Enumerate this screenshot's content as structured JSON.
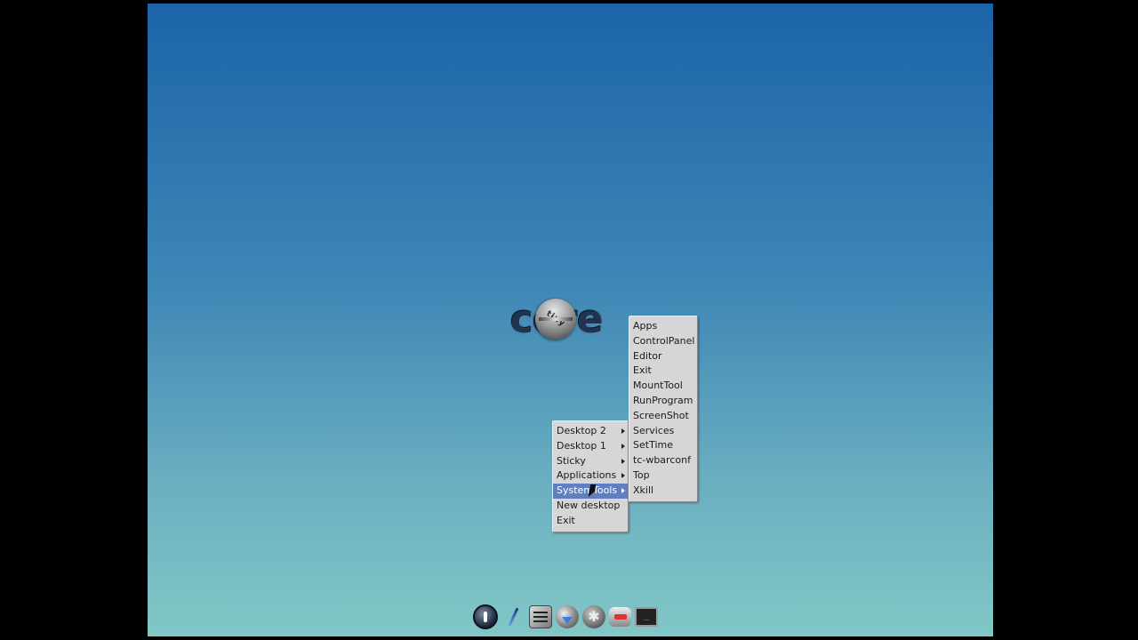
{
  "logo": {
    "text": "core",
    "badge": "tiny"
  },
  "desktop_menu": {
    "items": [
      {
        "label": "Desktop 2",
        "has_submenu": true
      },
      {
        "label": "Desktop 1",
        "has_submenu": true
      },
      {
        "label": "Sticky",
        "has_submenu": true
      },
      {
        "label": "Applications",
        "has_submenu": true
      },
      {
        "label": "SystemTools",
        "has_submenu": true,
        "active": true
      },
      {
        "label": "New desktop",
        "has_submenu": false
      },
      {
        "label": "Exit",
        "has_submenu": false
      }
    ]
  },
  "system_tools_menu": {
    "items": [
      "Apps",
      "ControlPanel",
      "Editor",
      "Exit",
      "MountTool",
      "RunProgram",
      "ScreenShot",
      "Services",
      "SetTime",
      "tc-wbarconf",
      "Top",
      "Xkill"
    ]
  },
  "dock": {
    "icons": [
      "power-icon",
      "editor-icon",
      "control-panel-icon",
      "mount-tool-icon",
      "apps-icon",
      "services-icon",
      "terminal-icon"
    ]
  },
  "colors": {
    "menu_bg": "#d6d6d6",
    "menu_highlight": "#5f7fc0",
    "desktop_top": "#1b64a8",
    "desktop_bottom": "#82c7c6"
  }
}
